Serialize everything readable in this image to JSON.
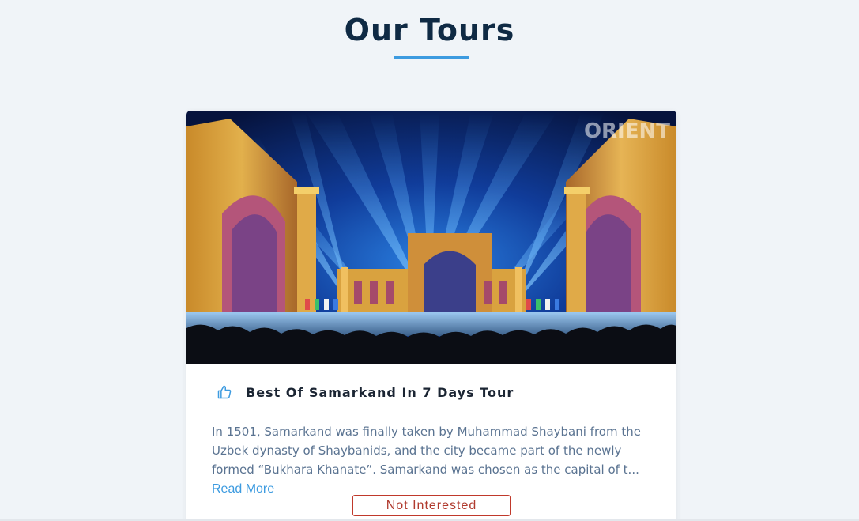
{
  "section": {
    "title": "Our Tours",
    "accent_color": "#3d9be0"
  },
  "tour_card": {
    "image_alt": "Registan square illuminated at night",
    "watermark": "ORIENT",
    "like_icon": "thumbs-up-icon",
    "title": "Best Of Samarkand In 7 Days Tour",
    "description": "In 1501, Samarkand was finally taken by Muhammad Shaybani from the Uzbek dynasty of Shaybanids, and the city became part of the newly formed “Bukhara Khanate”. Samarkand was chosen as the capital of t...",
    "read_more_label": "Read More",
    "not_interested_label": "Not Interested",
    "not_interested_color": "#c0392b"
  }
}
